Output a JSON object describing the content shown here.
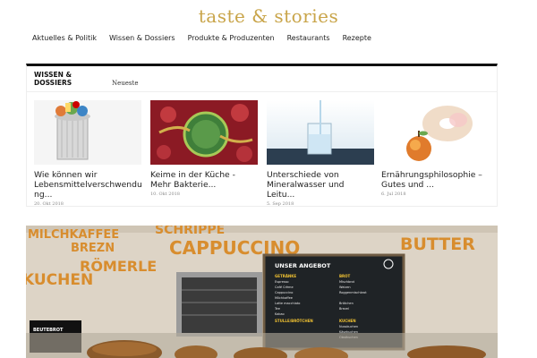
{
  "site": {
    "logo": "taste & stories"
  },
  "nav": {
    "items": [
      {
        "label": "Aktuelles & Politik"
      },
      {
        "label": "Wissen & Dossiers"
      },
      {
        "label": "Produkte & Produzenten"
      },
      {
        "label": "Restaurants"
      },
      {
        "label": "Rezepte"
      }
    ]
  },
  "section": {
    "title": "WISSEN & DOSSIERS",
    "tab": "Neueste",
    "cards": [
      {
        "title": "Wie können wir Lebensmittelverschwendu ng...",
        "date": "20. Okt 2018"
      },
      {
        "title": "Keime in der Küche - Mehr Bakterie...",
        "date": "10. Okt 2018"
      },
      {
        "title": "Unterschiede von Mineralwasser und Leitu...",
        "date": "5. Sep 2018"
      },
      {
        "title": "Ernährungsphilosophie – Gutes und ...",
        "date": "6. Jul 2018"
      }
    ]
  },
  "hero": {
    "signs": [
      "MILCHKAFFEE",
      "SCHRIPPE",
      "CAPPUCCINO",
      "BUTTER",
      "BREZN",
      "RÖMERLE",
      "KUCHEN"
    ],
    "board": {
      "title": "UNSER ANGEBOT",
      "col1_head": "GETRÄNKE",
      "col1_items": [
        "Espresso",
        "Café Crème",
        "Cappuccino",
        "Milchkaffee",
        "Latte macchiato",
        "Tee",
        "Kakao"
      ],
      "col2_head": "BROT",
      "col2_items": [
        "Mischbrot",
        "Weizen",
        "Roggenmischbrot",
        "",
        "Brötchen",
        "Brezel"
      ],
      "col1b_head": "STULLE/BRÖTCHEN",
      "col2b_head": "KUCHEN",
      "col2b_items": [
        "Nusskuchen",
        "Käsekuchen",
        "Obstkuchen"
      ]
    },
    "tag": "BEUTEBROT"
  }
}
